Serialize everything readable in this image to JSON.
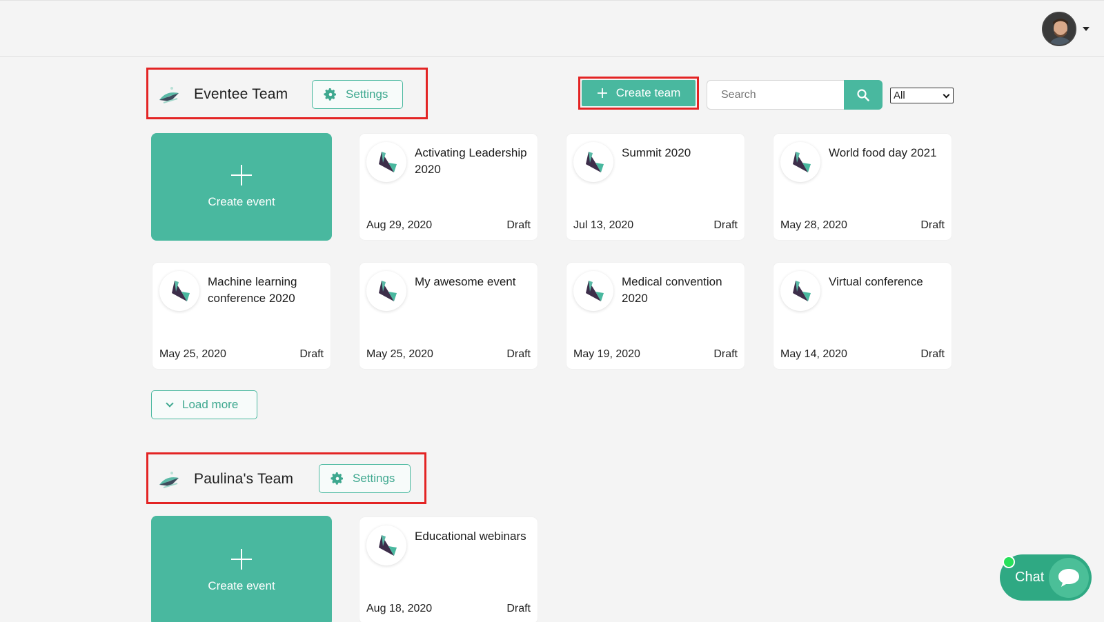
{
  "header": {
    "avatar_alt": "user avatar"
  },
  "toolbar": {
    "create_team_label": "Create team",
    "search_placeholder": "Search",
    "filter_selected": "All"
  },
  "teams": [
    {
      "name": "Eventee Team",
      "settings_label": "Settings",
      "create_event_label": "Create event",
      "events": [
        {
          "title": "Activating Leadership 2020",
          "date": "Aug 29, 2020",
          "status": "Draft"
        },
        {
          "title": "Summit 2020",
          "date": "Jul 13, 2020",
          "status": "Draft"
        },
        {
          "title": "World food day 2021",
          "date": "May 28, 2020",
          "status": "Draft"
        },
        {
          "title": "Machine learning conference 2020",
          "date": "May 25, 2020",
          "status": "Draft"
        },
        {
          "title": "My awesome event",
          "date": "May 25, 2020",
          "status": "Draft"
        },
        {
          "title": "Medical convention 2020",
          "date": "May 19, 2020",
          "status": "Draft"
        },
        {
          "title": "Virtual conference",
          "date": "May 14, 2020",
          "status": "Draft"
        }
      ],
      "load_more_label": "Load more"
    },
    {
      "name": "Paulina's Team",
      "settings_label": "Settings",
      "create_event_label": "Create event",
      "events": [
        {
          "title": "Educational webinars",
          "date": "Aug 18, 2020",
          "status": "Draft"
        }
      ]
    }
  ],
  "chat": {
    "label": "Chat"
  },
  "colors": {
    "accent": "#49b89f",
    "highlight": "#e32424",
    "chat": "#2fa983",
    "online": "#27e05a"
  }
}
